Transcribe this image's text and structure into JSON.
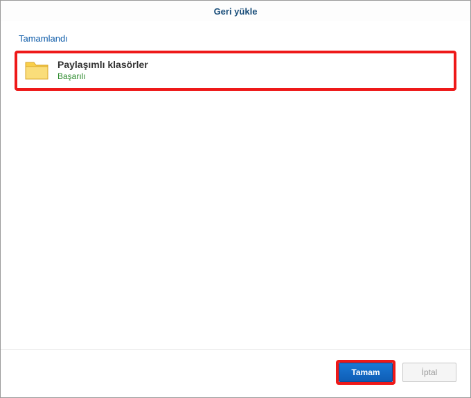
{
  "dialog": {
    "title": "Geri yükle"
  },
  "section": {
    "title": "Tamamlandı"
  },
  "item": {
    "title": "Paylaşımlı klasörler",
    "status": "Başarılı"
  },
  "buttons": {
    "ok": "Tamam",
    "cancel": "İptal"
  }
}
